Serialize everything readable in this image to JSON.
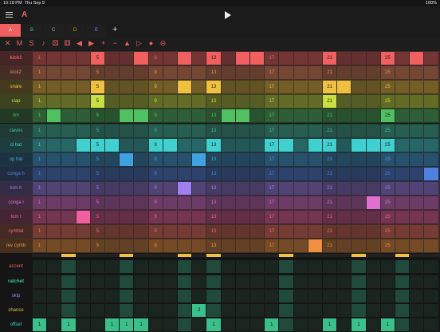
{
  "status": {
    "time": "10:18 PM",
    "date": "Thu Sep 9",
    "battery": "100%"
  },
  "header": {
    "pattern": "A",
    "menu_icon": "hamburger-menu-icon",
    "play_icon": "play-icon"
  },
  "tabs": [
    {
      "label": "A",
      "color": "#f06060",
      "active": true
    },
    {
      "label": "B",
      "color": "#3ac08a",
      "active": false
    },
    {
      "label": "C",
      "color": "#aaaaaa",
      "active": false
    },
    {
      "label": "D",
      "color": "#c8b000",
      "active": false
    },
    {
      "label": "E",
      "color": "#7a7aff",
      "active": false
    }
  ],
  "add_tab_label": "+",
  "toolbar_icons": [
    {
      "name": "clear-icon",
      "glyph": "✕"
    },
    {
      "name": "mute-icon",
      "glyph": "M"
    },
    {
      "name": "solo-icon",
      "glyph": "S"
    },
    {
      "name": "note-icon",
      "glyph": "♪"
    },
    {
      "name": "dice-icon",
      "glyph": "⚄"
    },
    {
      "name": "dice-alt-icon",
      "glyph": "⚅"
    },
    {
      "name": "shift-left-icon",
      "glyph": "◀"
    },
    {
      "name": "shift-right-icon",
      "glyph": "▶"
    },
    {
      "name": "add-icon",
      "glyph": "+"
    },
    {
      "name": "remove-icon",
      "glyph": "−"
    },
    {
      "name": "accent-icon",
      "glyph": "▲"
    },
    {
      "name": "velocity-icon",
      "glyph": "▷"
    },
    {
      "name": "record-icon",
      "glyph": "●"
    },
    {
      "name": "minus-circle-icon",
      "glyph": "⊖"
    }
  ],
  "step_numbers": [
    "1",
    "5",
    "9",
    "13",
    "17",
    "21",
    "25"
  ],
  "tracks": [
    {
      "name": "kick1",
      "color": "#f06060",
      "active": [
        4,
        7,
        10,
        12,
        14,
        15,
        20,
        24,
        26
      ],
      "bold": true
    },
    {
      "name": "kick2",
      "color": "#f08a60",
      "active": []
    },
    {
      "name": "snare",
      "color": "#f0c040",
      "active": [
        4,
        10,
        12,
        20,
        21
      ]
    },
    {
      "name": "clap",
      "color": "#c8e040",
      "active": [
        4,
        20
      ]
    },
    {
      "name": "rim",
      "color": "#50c060",
      "active": [
        1,
        6,
        7,
        13,
        14,
        24
      ]
    },
    {
      "name": "claves",
      "color": "#40c0a0",
      "active": []
    },
    {
      "name": "cl hat",
      "color": "#40d0d0",
      "active": [
        3,
        4,
        5,
        8,
        9,
        12,
        16,
        17,
        19,
        20,
        22,
        23,
        24
      ]
    },
    {
      "name": "op hat",
      "color": "#40a0e0",
      "active": [
        6,
        11
      ]
    },
    {
      "name": "conga h",
      "color": "#5080e0",
      "active": [
        27
      ]
    },
    {
      "name": "tom h",
      "color": "#a080f0",
      "active": [
        10
      ]
    },
    {
      "name": "conga l",
      "color": "#e070d0",
      "active": [
        23
      ]
    },
    {
      "name": "tom l",
      "color": "#f060a0",
      "active": [
        3
      ]
    },
    {
      "name": "cymbal",
      "color": "#f07060",
      "active": []
    },
    {
      "name": "rev cymb",
      "color": "#f09040",
      "active": [
        19
      ]
    }
  ],
  "params": [
    {
      "name": "accent",
      "color": "#f06060"
    },
    {
      "name": "ratchet",
      "color": "#3ac08a",
      "bold": true
    },
    {
      "name": "skip",
      "color": "#a080f0"
    },
    {
      "name": "chance",
      "color": "#e0c040",
      "values": {
        "11": "2"
      }
    },
    {
      "name": "offset",
      "color": "#40d0d0",
      "values": {
        "0": "1",
        "2": "1",
        "5": "1",
        "6": "1",
        "7": "1",
        "12": "1",
        "16": "1",
        "20": "1",
        "22": "1",
        "24": "1"
      }
    }
  ],
  "accent_steps": [
    2,
    6,
    10,
    12,
    17,
    22,
    25
  ],
  "colors": {
    "bg": "#151515",
    "cell_bg": "#2a2a2a",
    "cell_alt": "#303030"
  }
}
